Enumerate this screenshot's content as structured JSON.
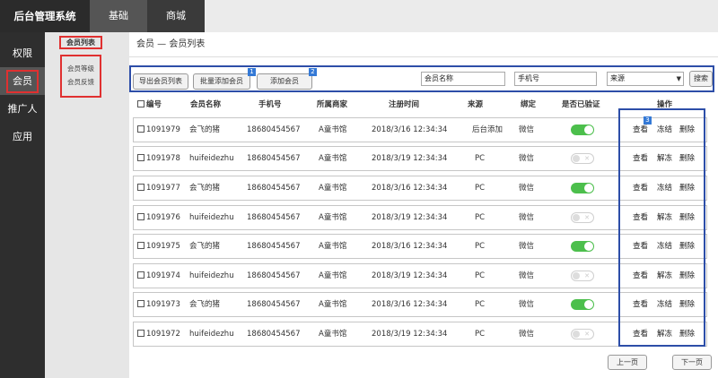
{
  "app": {
    "title": "后台管理系统"
  },
  "top_nav": [
    {
      "label": "基础",
      "active": true
    },
    {
      "label": "商城",
      "active": false
    }
  ],
  "sidebar": {
    "items": [
      {
        "label": "权限"
      },
      {
        "label": "会员",
        "active": true
      },
      {
        "label": "推广人"
      },
      {
        "label": "应用"
      }
    ]
  },
  "subnav": {
    "title": "会员列表",
    "items": [
      "会员等级",
      "会员反馈"
    ]
  },
  "breadcrumb": "会员 — 会员列表",
  "toolbar": {
    "export_label": "导出会员列表",
    "batch_add_label": "批量添加会员",
    "batch_add_badge": "1",
    "add_label": "添加会员",
    "add_badge": "2",
    "name_value": "会员名称",
    "phone_value": "手机号",
    "source_value": "来源",
    "search_label": "搜索"
  },
  "table": {
    "headers": {
      "id": "编号",
      "name": "会员名称",
      "phone": "手机号",
      "merchant": "所属商家",
      "reg_time": "注册时间",
      "source": "来源",
      "bind": "绑定",
      "verified": "是否已验证",
      "ops": "操作"
    },
    "rows": [
      {
        "id": "1091979",
        "name": "会飞的猪",
        "phone": "18680454567",
        "merchant": "A童书馆",
        "time": "2018/3/16 12:34:34",
        "source": "后台添加",
        "bind": "微信",
        "verified": true,
        "ops": [
          "查看",
          "冻结",
          "删除"
        ]
      },
      {
        "id": "1091978",
        "name": "huifeidezhu",
        "phone": "18680454567",
        "merchant": "A童书馆",
        "time": "2018/3/19 12:34:34",
        "source": "PC",
        "bind": "微信",
        "verified": false,
        "ops": [
          "查看",
          "解冻",
          "删除"
        ]
      },
      {
        "id": "1091977",
        "name": "会飞的猪",
        "phone": "18680454567",
        "merchant": "A童书馆",
        "time": "2018/3/16 12:34:34",
        "source": "PC",
        "bind": "微信",
        "verified": true,
        "ops": [
          "查看",
          "冻结",
          "删除"
        ]
      },
      {
        "id": "1091976",
        "name": "huifeidezhu",
        "phone": "18680454567",
        "merchant": "A童书馆",
        "time": "2018/3/19 12:34:34",
        "source": "PC",
        "bind": "微信",
        "verified": false,
        "ops": [
          "查看",
          "解冻",
          "删除"
        ]
      },
      {
        "id": "1091975",
        "name": "会飞的猪",
        "phone": "18680454567",
        "merchant": "A童书馆",
        "time": "2018/3/16 12:34:34",
        "source": "PC",
        "bind": "微信",
        "verified": true,
        "ops": [
          "查看",
          "冻结",
          "删除"
        ]
      },
      {
        "id": "1091974",
        "name": "huifeidezhu",
        "phone": "18680454567",
        "merchant": "A童书馆",
        "time": "2018/3/19 12:34:34",
        "source": "PC",
        "bind": "微信",
        "verified": false,
        "ops": [
          "查看",
          "解冻",
          "删除"
        ]
      },
      {
        "id": "1091973",
        "name": "会飞的猪",
        "phone": "18680454567",
        "merchant": "A童书馆",
        "time": "2018/3/16 12:34:34",
        "source": "PC",
        "bind": "微信",
        "verified": true,
        "ops": [
          "查看",
          "冻结",
          "删除"
        ]
      },
      {
        "id": "1091972",
        "name": "huifeidezhu",
        "phone": "18680454567",
        "merchant": "A童书馆",
        "time": "2018/3/19 12:34:34",
        "source": "PC",
        "bind": "微信",
        "verified": false,
        "ops": [
          "查看",
          "解冻",
          "删除"
        ]
      }
    ],
    "ops_badge": "3"
  },
  "pager": {
    "prev_label": "上一页",
    "next_label": "下一页"
  },
  "colors": {
    "highlight_red": "#e03030",
    "highlight_blue": "#2d4ea8",
    "toggle_on": "#4cbf4c",
    "badge_blue": "#3479d6"
  }
}
